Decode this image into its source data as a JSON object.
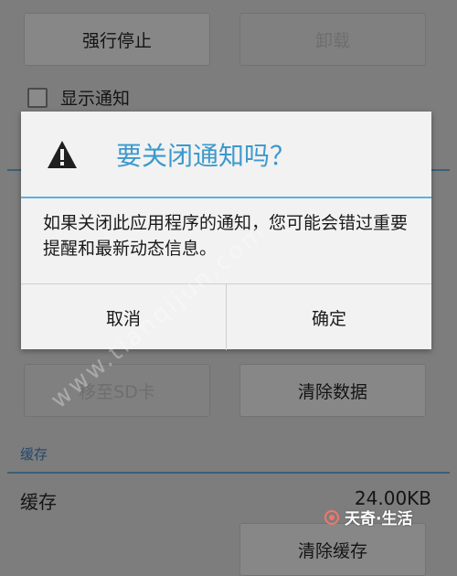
{
  "app_details": {
    "force_stop_label": "强行停止",
    "uninstall_label": "卸载",
    "show_notifications_label": "显示通知",
    "move_to_sd_label": "移至SD卡",
    "clear_data_label": "清除数据",
    "cache_section_header": "缓存",
    "cache_row_label": "缓存",
    "cache_size": "24.00KB",
    "clear_cache_label": "清除缓存"
  },
  "dialog": {
    "icon": "warning-icon",
    "title": "要关闭通知吗？",
    "message": "如果关闭此应用程序的通知，您可能会错过重要提醒和最新动态信息。",
    "cancel_label": "取消",
    "confirm_label": "确定",
    "accent_color": "#3c99cc"
  },
  "watermark": {
    "diagonal_text": "www.tianqijun.com",
    "brand_text": "天奇·生活"
  }
}
